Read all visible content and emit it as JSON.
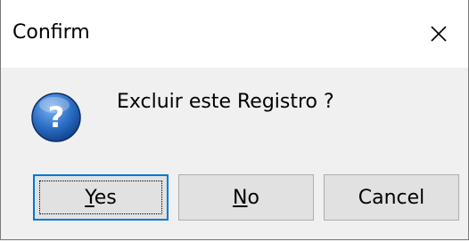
{
  "window": {
    "title": "Confirm",
    "close_glyph": "close-icon"
  },
  "message": {
    "icon": "question-icon",
    "text": "Excluir este Registro ?"
  },
  "buttons": {
    "yes": {
      "accel": "Y",
      "rest": "es"
    },
    "no": {
      "accel": "N",
      "rest": "o"
    },
    "cancel": "Cancel"
  },
  "colors": {
    "focus_border": "#0078d7",
    "icon_blue": "#1d5fb8",
    "dialog_bg": "#f0f0f0"
  }
}
